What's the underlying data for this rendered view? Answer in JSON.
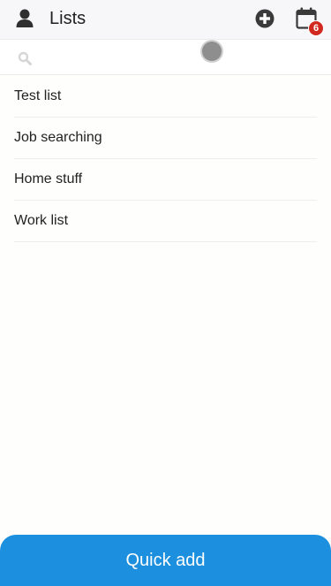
{
  "header": {
    "title": "Lists",
    "profile_icon": "user-icon",
    "add_icon": "plus-circle-icon",
    "calendar_icon": "calendar-icon",
    "calendar_badge": "6",
    "badge_color": "#d1281f"
  },
  "search": {
    "placeholder": "",
    "value": "",
    "icon": "search-icon"
  },
  "lists": [
    {
      "label": "Test list"
    },
    {
      "label": "Job searching"
    },
    {
      "label": "Home stuff"
    },
    {
      "label": "Work list"
    }
  ],
  "footer": {
    "quick_add_label": "Quick add",
    "accent_color": "#1c8fde"
  }
}
